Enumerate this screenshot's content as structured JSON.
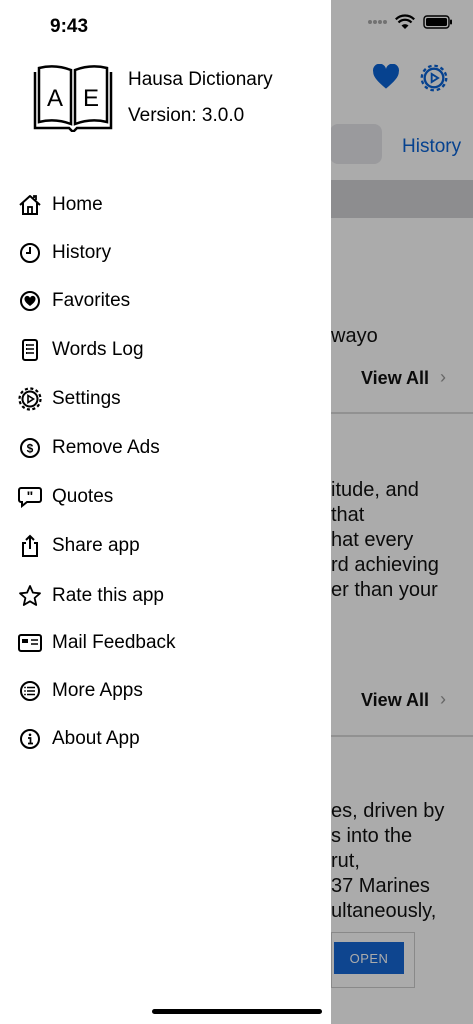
{
  "status_bar": {
    "time": "9:43"
  },
  "drawer": {
    "app_name": "Hausa Dictionary",
    "version": "Version: 3.0.0",
    "logo_letters": [
      "A",
      "E"
    ],
    "items": [
      {
        "label": "Home",
        "icon": "home-icon"
      },
      {
        "label": "History",
        "icon": "clock-icon"
      },
      {
        "label": "Favorites",
        "icon": "heart-circle-icon"
      },
      {
        "label": "Words Log",
        "icon": "notebook-icon"
      },
      {
        "label": "Settings",
        "icon": "gear-icon"
      },
      {
        "label": "Remove Ads",
        "icon": "dollar-circle-icon"
      },
      {
        "label": "Quotes",
        "icon": "quote-bubble-icon"
      },
      {
        "label": "Share app",
        "icon": "share-icon"
      },
      {
        "label": "Rate this app",
        "icon": "star-icon"
      },
      {
        "label": "Mail Feedback",
        "icon": "mail-card-icon"
      },
      {
        "label": "More Apps",
        "icon": "list-circle-icon"
      },
      {
        "label": "About App",
        "icon": "info-circle-icon"
      }
    ]
  },
  "background": {
    "history_link": "History",
    "word_fragment": "wayo",
    "view_all_1": "View All",
    "quote_lines": [
      "itude, and",
      "that",
      "hat every",
      "rd achieving",
      "er than your"
    ],
    "view_all_2": "View All",
    "article_lines": [
      "es, driven by",
      "s into the",
      "rut,",
      "37 Marines",
      "ultaneously,"
    ],
    "ad_button": "OPEN",
    "accent_color": "#0a63d6"
  }
}
